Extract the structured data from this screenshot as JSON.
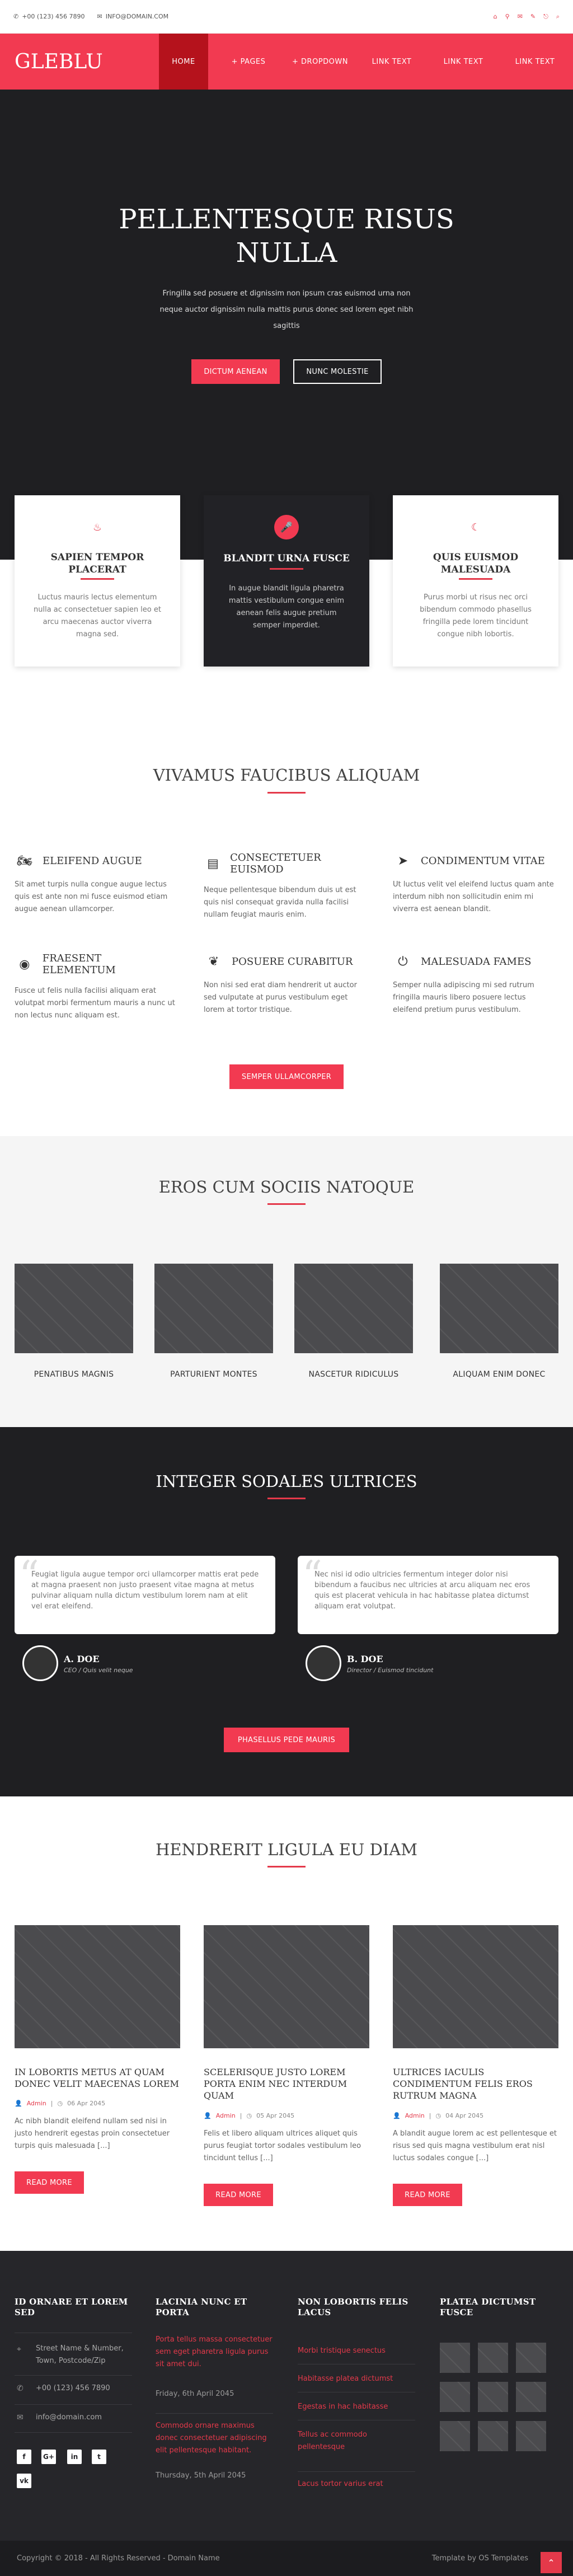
{
  "topbar": {
    "phone": "+00 (123) 456 7890",
    "email": "INFO@DOMAIN.COM",
    "social_icons": [
      "home-icon",
      "search-icon",
      "email-icon",
      "edit-icon",
      "checkin-icon",
      "search-icon"
    ]
  },
  "nav": {
    "logo": "GLEBLU",
    "items": [
      {
        "label": "HOME"
      },
      {
        "label": "+ PAGES"
      },
      {
        "label": "+ DROPDOWN"
      },
      {
        "label": "LINK TEXT"
      },
      {
        "label": "LINK TEXT"
      },
      {
        "label": "LINK TEXT"
      }
    ]
  },
  "hero": {
    "title_line1": "PELLENTESQUE RISUS",
    "title_line2": "NULLA",
    "text": "Fringilla sed posuere et dignissim non ipsum cras euismod urna non neque auctor dignissim nulla mattis purus donec sed lorem eget nibh sagittis",
    "button1": "DICTUM AENEAN",
    "button2": "NUNC MOLESTIE"
  },
  "features": [
    {
      "title": "SAPIEN TEMPOR PLACERAT",
      "text": "Luctus mauris lectus elementum nulla ac consectetuer sapien leo et arcu maecenas auctor viverra magna sed."
    },
    {
      "title": "BLANDIT URNA FUSCE",
      "text": "In augue blandit ligula pharetra mattis vestibulum congue enim aenean felis augue pretium semper imperdiet."
    },
    {
      "title": "QUIS EUISMOD MALESUADA",
      "text": "Purus morbi ut risus nec orci bibendum commodo phasellus fringilla pede lorem tincidunt congue nibh lobortis."
    }
  ],
  "services": {
    "title": "VIVAMUS FAUCIBUS ALIQUAM",
    "items": [
      {
        "icon": "motorcycle-icon",
        "title": "ELEIFEND AUGUE",
        "text": "Sit amet turpis nulla congue augue lectus quis est ante non mi fusce euismod etiam augue aenean ullamcorper."
      },
      {
        "icon": "newspaper-icon",
        "title": "CONSECTETUER EUISMOD",
        "text": "Neque pellentesque bibendum duis ut est quis nisl consequat gravida nulla facilisi nullam feugiat mauris enim."
      },
      {
        "icon": "paper-plane-icon",
        "title": "CONDIMENTUM VITAE",
        "text": "Ut luctus velit vel eleifend luctus quam ante interdum nibh non sollicitudin enim mi viverra est aenean blandit."
      },
      {
        "icon": "eye-icon",
        "title": "FRAESENT ELEMENTUM",
        "text": "Fusce ut felis nulla facilisi aliquam erat volutpat morbi fermentum mauris a nunc ut non lectus nunc aliquam est."
      },
      {
        "icon": "leaf-icon",
        "title": "POSUERE CURABITUR",
        "text": "Non nisi sed erat diam hendrerit ut auctor sed vulputate at purus vestibulum eget lorem at tortor tristique."
      },
      {
        "icon": "power-icon",
        "title": "MALESUADA FAMES",
        "text": "Semper nulla adipiscing mi sed rutrum fringilla mauris libero posuere lectus eleifend pretium purus vestibulum."
      }
    ],
    "button": "SEMPER ULLAMCORPER"
  },
  "portfolio": {
    "title": "EROS CUM SOCIIS NATOQUE",
    "items": [
      {
        "caption": "PENATIBUS MAGNIS"
      },
      {
        "caption": "PARTURIENT MONTES"
      },
      {
        "caption": "NASCETUR RIDICULUS"
      },
      {
        "caption": "ALIQUAM ENIM DONEC"
      }
    ]
  },
  "testimonials": {
    "title": "INTEGER SODALES ULTRICES",
    "items": [
      {
        "text": "Feugiat ligula augue tempor orci ullamcorper mattis erat pede at magna praesent non justo praesent vitae magna at metus pulvinar aliquam nulla dictum vestibulum lorem nam at elit vel erat eleifend.",
        "name": "A. DOE",
        "role": "CEO / Quis velit neque"
      },
      {
        "text": "Nec nisi id odio ultricies fermentum integer dolor nisi bibendum a faucibus nec ultricies at arcu aliquam nec eros quis est placerat vehicula in hac habitasse platea dictumst aliquam erat volutpat.",
        "name": "B. DOE",
        "role": "Director / Euismod tincidunt"
      }
    ],
    "button": "PHASELLUS PEDE MAURIS"
  },
  "blog": {
    "title": "HENDRERIT LIGULA EU DIAM",
    "posts": [
      {
        "title": "IN LOBORTIS METUS AT QUAM DONEC VELIT MAECENAS LOREM",
        "author": "Admin",
        "date": "06 Apr 2045",
        "text": "Ac nibh blandit eleifend nullam sed nisi in justo hendrerit egestas proin consectetuer turpis quis malesuada [...]",
        "button": "READ MORE"
      },
      {
        "title": "SCELERISQUE JUSTO LOREM PORTA ENIM NEC INTERDUM QUAM",
        "author": "Admin",
        "date": "05 Apr 2045",
        "text": "Felis et libero aliquam ultrices aliquet quis purus feugiat tortor sodales vestibulum leo tincidunt tellus [...]",
        "button": "READ MORE"
      },
      {
        "title": "ULTRICES IACULIS CONDIMENTUM FELIS EROS RUTRUM MAGNA",
        "author": "Admin",
        "date": "04 Apr 2045",
        "text": "A blandit augue lorem ac est pellentesque et risus sed quis magna vestibulum erat nisl luctus sodales congue [...]",
        "button": "READ MORE"
      }
    ]
  },
  "footer": {
    "col1": {
      "title": "ID ORNARE ET LOREM SED",
      "address": "Street Name & Number, Town, Postcode/Zip",
      "phone": "+00 (123) 456 7890",
      "email": "info@domain.com",
      "social": [
        "f",
        "G+",
        "in",
        "t",
        "vk"
      ]
    },
    "col2": {
      "title": "LACINIA NUNC ET PORTA",
      "posts": [
        {
          "text": "Porta tellus massa consectetuer sem eget pharetra ligula purus sit amet dui.",
          "date": "Friday, 6th April 2045"
        },
        {
          "text": "Commodo ornare maximus donec consectetuer adipiscing elit pellentesque habitant.",
          "date": "Thursday, 5th April 2045"
        }
      ]
    },
    "col3": {
      "title": "NON LOBORTIS FELIS LACUS",
      "links": [
        "Morbi tristique senectus",
        "Habitasse platea dictumst",
        "Egestas in hac habitasse",
        "Tellus ac commodo pellentesque",
        "Lacus tortor varius erat"
      ]
    },
    "col4": {
      "title": "PLATEA DICTUMST FUSCE"
    },
    "copyright": "Copyright © 2018 - All Rights Reserved - Domain Name",
    "credit": "Template by OS Templates"
  }
}
